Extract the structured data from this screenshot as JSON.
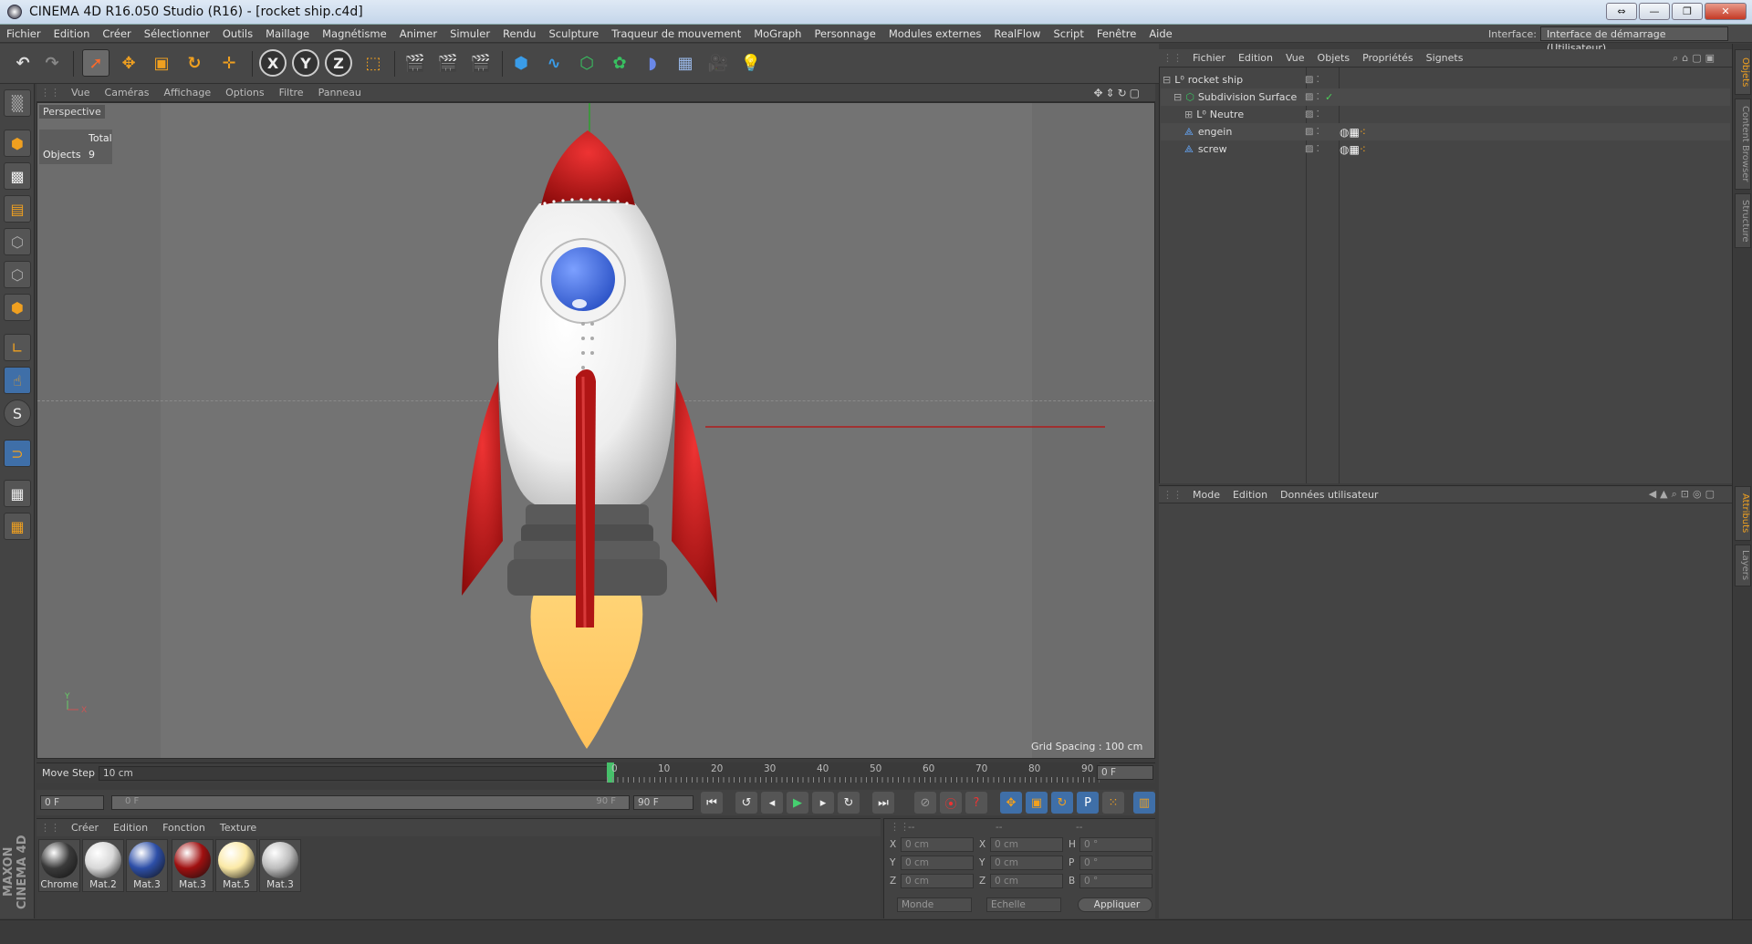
{
  "window": {
    "title": "CINEMA 4D R16.050 Studio (R16) - [rocket ship.c4d]"
  },
  "menu": [
    "Fichier",
    "Edition",
    "Créer",
    "Sélectionner",
    "Outils",
    "Maillage",
    "Magnétisme",
    "Animer",
    "Simuler",
    "Rendu",
    "Sculpture",
    "Traqueur de mouvement",
    "MoGraph",
    "Personnage",
    "Modules externes",
    "RealFlow",
    "Script",
    "Fenêtre",
    "Aide"
  ],
  "interface": {
    "label": "Interface:",
    "value": "Interface de démarrage (Utilisateur)"
  },
  "toolbar": {
    "x": "X",
    "y": "Y",
    "z": "Z"
  },
  "viewport": {
    "menu": [
      "Vue",
      "Caméras",
      "Affichage",
      "Options",
      "Filtre",
      "Panneau"
    ],
    "camera": "Perspective",
    "hud": {
      "header": "Total",
      "label": "Objects",
      "value": "9"
    },
    "grid_spacing": "Grid Spacing : 100 cm"
  },
  "timeline": {
    "move_step_label": "Move Step",
    "move_step_value": "10 cm",
    "ticks": [
      "0",
      "10",
      "20",
      "30",
      "40",
      "50",
      "60",
      "70",
      "80",
      "90"
    ],
    "current_frame": "0 F",
    "start": "0 F",
    "range_start": "0 F",
    "range_end": "90 F",
    "end": "90 F"
  },
  "materials": {
    "menu": [
      "Créer",
      "Edition",
      "Fonction",
      "Texture"
    ],
    "items": [
      {
        "name": "Chrome",
        "color": "#3a3a3a"
      },
      {
        "name": "Mat.2",
        "color": "#d8d8d8"
      },
      {
        "name": "Mat.3",
        "color": "#2d4fa8"
      },
      {
        "name": "Mat.3",
        "color": "#a01010"
      },
      {
        "name": "Mat.5",
        "color": "#fbe9a6"
      },
      {
        "name": "Mat.3",
        "color": "#bdbdbd"
      }
    ]
  },
  "coords": {
    "headers": [
      "--",
      "--",
      "--"
    ],
    "rows": [
      {
        "a": "X",
        "av": "0 cm",
        "b": "X",
        "bv": "0 cm",
        "c": "H",
        "cv": "0 °"
      },
      {
        "a": "Y",
        "av": "0 cm",
        "b": "Y",
        "bv": "0 cm",
        "c": "P",
        "cv": "0 °"
      },
      {
        "a": "Z",
        "av": "0 cm",
        "b": "Z",
        "bv": "0 cm",
        "c": "B",
        "cv": "0 °"
      }
    ],
    "space": "Monde",
    "mode": "Echelle",
    "apply": "Appliquer"
  },
  "objects": {
    "menu": [
      "Fichier",
      "Edition",
      "Vue",
      "Objets",
      "Propriétés",
      "Signets"
    ],
    "rows": [
      {
        "name": "rocket ship"
      },
      {
        "name": "Subdivision Surface"
      },
      {
        "name": "Neutre"
      },
      {
        "name": "engein"
      },
      {
        "name": "screw"
      }
    ]
  },
  "attributes": {
    "menu": [
      "Mode",
      "Edition",
      "Données utilisateur"
    ]
  },
  "side_tabs": [
    "Objets",
    "Content Browser",
    "Structure",
    "Attributs",
    "Layers"
  ],
  "brand": "MAXON CINEMA 4D"
}
